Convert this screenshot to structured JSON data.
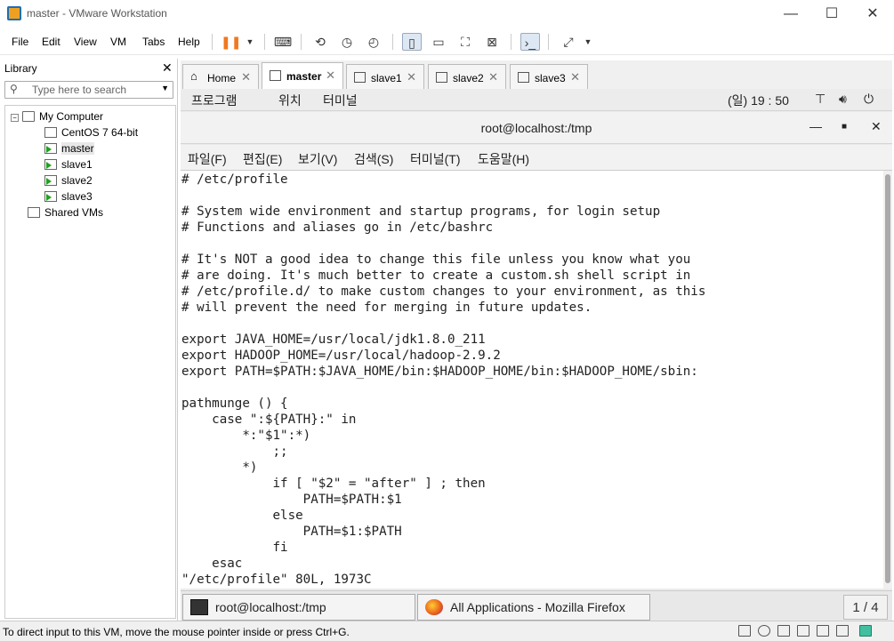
{
  "window": {
    "title": "master - VMware Workstation",
    "minimize": "—",
    "maximize": "☐",
    "close": "✕"
  },
  "menubar": {
    "items": [
      "File",
      "Edit",
      "View",
      "VM",
      "Tabs",
      "Help"
    ]
  },
  "library": {
    "title": "Library",
    "close": "✕",
    "search_placeholder": "Type here to search",
    "tree": {
      "root": "My Computer",
      "vms": [
        "CentOS 7 64-bit",
        "master",
        "slave1",
        "slave2",
        "slave3"
      ],
      "selected": "master",
      "shared": "Shared VMs"
    }
  },
  "tabs": [
    {
      "label": "Home",
      "close": "✕",
      "active": false
    },
    {
      "label": "master",
      "close": "✕",
      "active": true
    },
    {
      "label": "slave1",
      "close": "✕",
      "active": false
    },
    {
      "label": "slave2",
      "close": "✕",
      "active": false
    },
    {
      "label": "slave3",
      "close": "✕",
      "active": false
    }
  ],
  "gnome": {
    "menus": [
      "프로그램",
      "위치",
      "터미널"
    ],
    "clock": "(일) 19 : 50"
  },
  "terminal": {
    "title": "root@localhost:/tmp",
    "menu": [
      "파일(F)",
      "편집(E)",
      "보기(V)",
      "검색(S)",
      "터미널(T)",
      "도움말(H)"
    ],
    "content": "# /etc/profile\n\n# System wide environment and startup programs, for login setup\n# Functions and aliases go in /etc/bashrc\n\n# It's NOT a good idea to change this file unless you know what you\n# are doing. It's much better to create a custom.sh shell script in\n# /etc/profile.d/ to make custom changes to your environment, as this\n# will prevent the need for merging in future updates.\n\nexport JAVA_HOME=/usr/local/jdk1.8.0_211\nexport HADOOP_HOME=/usr/local/hadoop-2.9.2\nexport PATH=$PATH:$JAVA_HOME/bin:$HADOOP_HOME/bin:$HADOOP_HOME/sbin:\n\npathmunge () {\n    case \":${PATH}:\" in\n        *:\"$1\":*)\n            ;;\n        *)\n            if [ \"$2\" = \"after\" ] ; then\n                PATH=$PATH:$1\n            else\n                PATH=$1:$PATH\n            fi\n    esac\n\"/etc/profile\" 80L, 1973C"
  },
  "taskbar": {
    "items": [
      "root@localhost:/tmp",
      "All Applications - Mozilla Firefox"
    ],
    "pager": "1 / 4"
  },
  "status": {
    "text": "To direct input to this VM, move the mouse pointer inside or press Ctrl+G."
  },
  "colors": {
    "accent": "#1a6fb5",
    "pause": "#f07820",
    "running": "#22a022"
  }
}
